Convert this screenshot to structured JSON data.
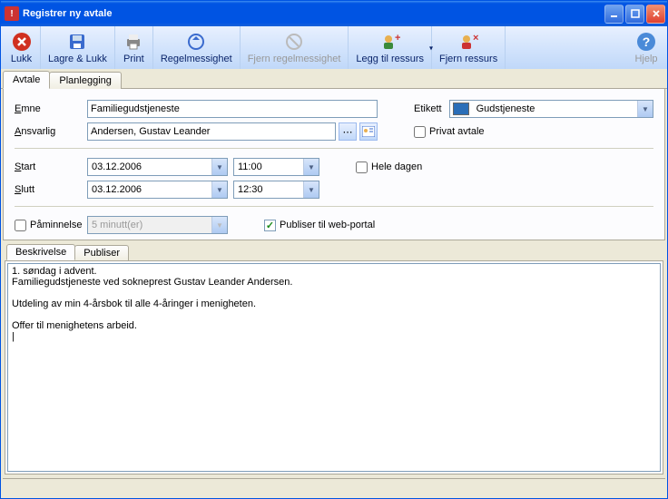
{
  "window": {
    "title": "Registrer ny avtale"
  },
  "toolbar": {
    "lukk": "Lukk",
    "lagre": "Lagre & Lukk",
    "print": "Print",
    "regel": "Regelmessighet",
    "fjern": "Fjern regelmessighet",
    "legg": "Legg til ressurs",
    "fjernres": "Fjern ressurs",
    "hjelp": "Hjelp"
  },
  "tabs": {
    "avtale": "Avtale",
    "planlegging": "Planlegging"
  },
  "labels": {
    "emne": "Emne",
    "emne_u": "E",
    "ansvarlig": "Ansvarlig",
    "ansvarlig_u": "A",
    "etikett": "Etikett",
    "privat": "Privat avtale",
    "privat_u": "P",
    "start": "Start",
    "start_u": "S",
    "slutt": "Slutt",
    "slutt_u": "S",
    "heledagen": "Hele dagen",
    "heledagen_u": "H",
    "paminnelse": "Påminnelse",
    "paminnelse_u": "P",
    "publiser": "Publiser til web-portal"
  },
  "values": {
    "emne": "Familiegudstjeneste",
    "ansvarlig": "Andersen, Gustav Leander",
    "etikett": "Gudstjeneste",
    "start_date": "03.12.2006",
    "start_time": "11:00",
    "slutt_date": "03.12.2006",
    "slutt_time": "12:30",
    "paminnelse": "5 minutt(er)"
  },
  "desctabs": {
    "beskrivelse": "Beskrivelse",
    "publiser": "Publiser"
  },
  "description": "1. søndag i advent.\nFamiliegudstjeneste ved sokneprest Gustav Leander Andersen.\n\nUtdeling av min 4-årsbok til alle 4-åringer i menigheten.\n\nOffer til menighetens arbeid.\n|"
}
